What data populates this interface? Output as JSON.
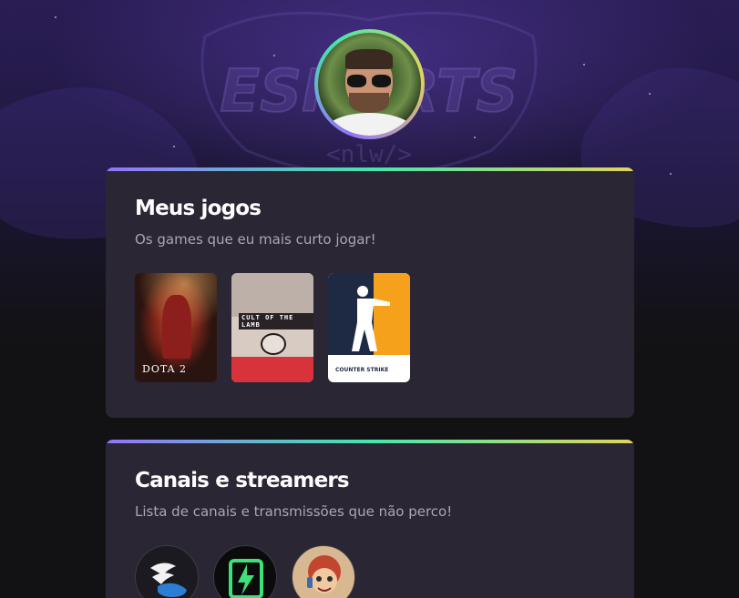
{
  "profile": {
    "avatar_icon": "profile-avatar"
  },
  "background": {
    "logo_text": "ESPORTS",
    "logo_sub": "<nlw/>"
  },
  "games_section": {
    "title": "Meus jogos",
    "subtitle": "Os games que eu mais curto jogar!",
    "games": [
      {
        "name": "DOTA 2"
      },
      {
        "name": "CULT OF THE LAMB"
      },
      {
        "name": "COUNTER STRIKE"
      }
    ]
  },
  "streamers_section": {
    "title": "Canais e streamers",
    "subtitle": "Lista de canais e transmissões que não perco!",
    "channels": [
      {
        "icon": "winged-shoe-icon"
      },
      {
        "icon": "green-lightning-icon"
      },
      {
        "icon": "cartoon-streamer-icon"
      }
    ]
  },
  "colors": {
    "gradient_start": "#9572fc",
    "gradient_mid": "#43e7ad",
    "gradient_end": "#e2d45c",
    "card_bg": "#2a2634"
  }
}
